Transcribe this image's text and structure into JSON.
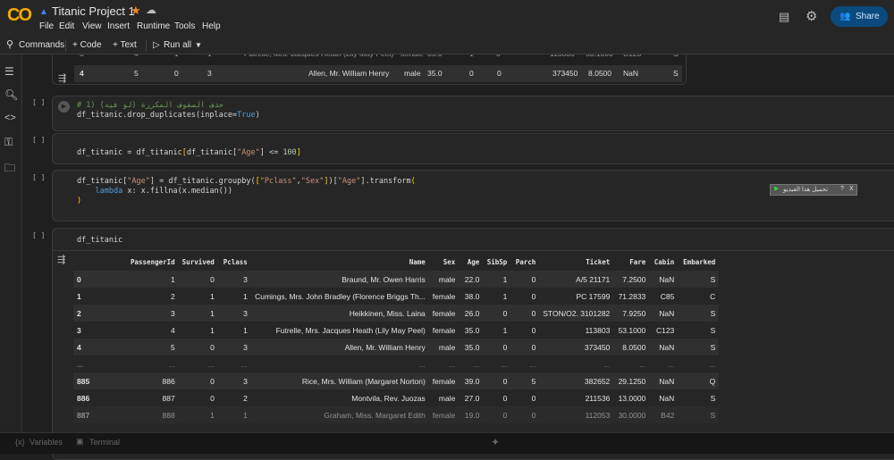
{
  "app": {
    "logo": "CO",
    "title": "Titanic Project 1",
    "menu": [
      "File",
      "Edit",
      "View",
      "Insert",
      "Runtime",
      "Tools",
      "Help"
    ],
    "share_label": "Share"
  },
  "toolbar": {
    "commands": "Commands",
    "code": "+ Code",
    "text": "+ Text",
    "run_all": "Run all"
  },
  "sidebar": {
    "icons": [
      "table-of-contents-icon",
      "find-icon",
      "code-snippets-icon",
      "secrets-key-icon",
      "files-folder-icon"
    ]
  },
  "cells": [
    {
      "bracket": "[ ]",
      "lines": [
        "# 1) حذف الصفوف المكررة (لو فيه)",
        "df_titanic.drop_duplicates(inplace=True)"
      ]
    },
    {
      "bracket": "[ ]",
      "lines": [
        "df_titanic = df_titanic[df_titanic[\"Age\"] <= 100]"
      ]
    },
    {
      "bracket": "[ ]",
      "lines": [
        "df_titanic[\"Age\"] = df_titanic.groupby([\"Pclass\",\"Sex\"])[\"Age\"].transform(",
        "    lambda x: x.fillna(x.median())",
        ")"
      ]
    },
    {
      "bracket": "[ ]",
      "lines": [
        "df_titanic"
      ]
    }
  ],
  "table": {
    "columns": [
      "",
      "PassengerId",
      "Survived",
      "Pclass",
      "Name",
      "Sex",
      "Age",
      "SibSp",
      "Parch",
      "Ticket",
      "Fare",
      "Cabin",
      "Embarked"
    ],
    "rows": [
      [
        "0",
        "1",
        "0",
        "3",
        "Braund, Mr. Owen Harris",
        "male",
        "22.0",
        "1",
        "0",
        "A/5 21171",
        "7.2500",
        "NaN",
        "S"
      ],
      [
        "1",
        "2",
        "1",
        "1",
        "Cumings, Mrs. John Bradley (Florence Briggs Th...",
        "female",
        "38.0",
        "1",
        "0",
        "PC 17599",
        "71.2833",
        "C85",
        "C"
      ],
      [
        "2",
        "3",
        "1",
        "3",
        "Heikkinen, Miss. Laina",
        "female",
        "26.0",
        "0",
        "0",
        "STON/O2. 3101282",
        "7.9250",
        "NaN",
        "S"
      ],
      [
        "3",
        "4",
        "1",
        "1",
        "Futrelle, Mrs. Jacques Heath (Lily May Peel)",
        "female",
        "35.0",
        "1",
        "0",
        "113803",
        "53.1000",
        "C123",
        "S"
      ],
      [
        "4",
        "5",
        "0",
        "3",
        "Allen, Mr. William Henry",
        "male",
        "35.0",
        "0",
        "0",
        "373450",
        "8.0500",
        "NaN",
        "S"
      ],
      [
        "...",
        "...",
        "...",
        "...",
        "...",
        "...",
        "...",
        "...",
        "...",
        "...",
        "...",
        "...",
        "..."
      ],
      [
        "885",
        "886",
        "0",
        "3",
        "Rice, Mrs. William (Margaret Norton)",
        "female",
        "39.0",
        "0",
        "5",
        "382652",
        "29.1250",
        "NaN",
        "Q"
      ],
      [
        "886",
        "887",
        "0",
        "2",
        "Montvila, Rev. Juozas",
        "male",
        "27.0",
        "0",
        "0",
        "211536",
        "13.0000",
        "NaN",
        "S"
      ],
      [
        "887",
        "888",
        "1",
        "1",
        "Graham, Miss. Margaret Edith",
        "female",
        "19.0",
        "0",
        "0",
        "112053",
        "30.0000",
        "B42",
        "S"
      ]
    ]
  },
  "floating_widget": {
    "label": "تحميل هذا الفيديو",
    "help": "?",
    "close": "X"
  },
  "bottombar": {
    "variables": "Variables",
    "terminal": "Terminal"
  }
}
